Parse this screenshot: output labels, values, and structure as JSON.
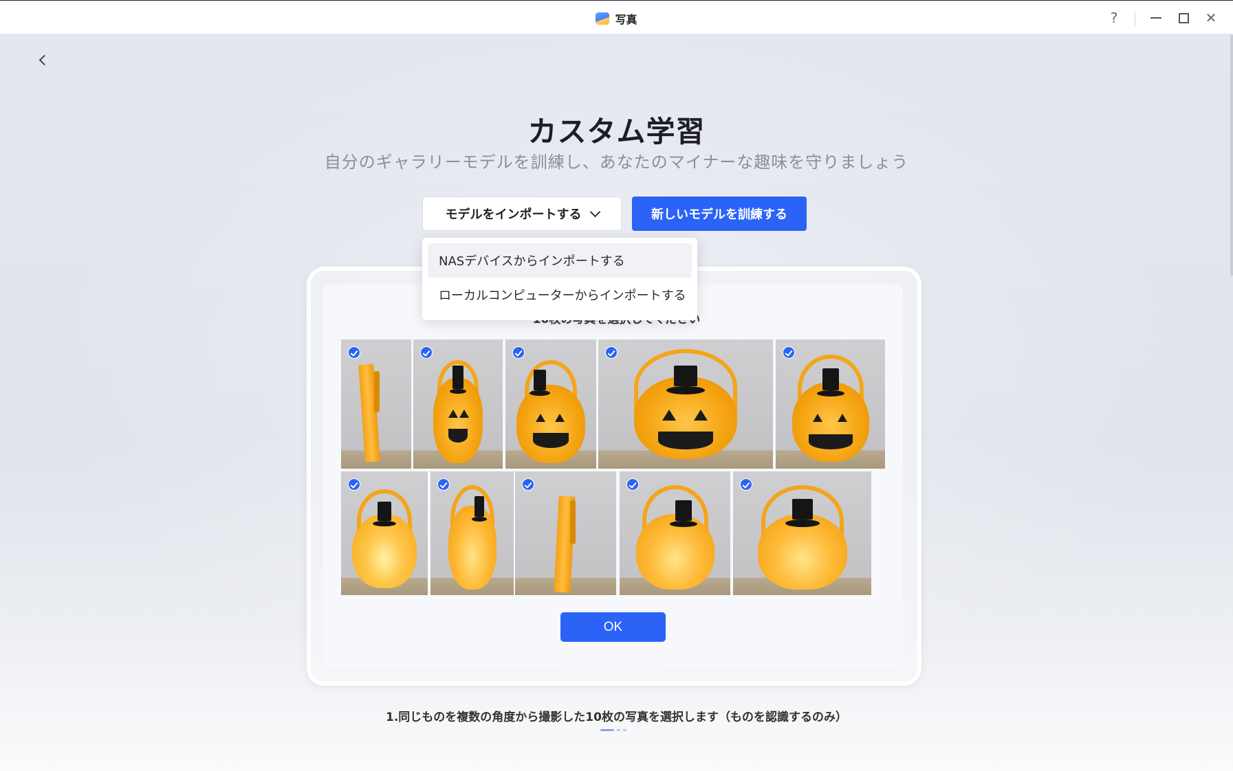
{
  "window": {
    "title": "写真",
    "help_label": "?",
    "close_label": "✕"
  },
  "page": {
    "title": "カスタム学習",
    "subtitle": "自分のギャラリーモデルを訓練し、あなたのマイナーな趣味を守りましょう"
  },
  "toolbar": {
    "import_label": "モデルをインポートする",
    "train_label": "新しいモデルを訓練する"
  },
  "dropdown": {
    "items": [
      {
        "label": "NASデバイスからインポートする",
        "highlighted": true
      },
      {
        "label": "ローカルコンピューターからインポートする",
        "highlighted": false
      }
    ]
  },
  "gallery": {
    "hint": "10枚の写真を選択してください",
    "photos": [
      {
        "subject": "pumpkin-basket-side-view",
        "selected": true
      },
      {
        "subject": "pumpkin-basket-angled-left",
        "selected": true
      },
      {
        "subject": "pumpkin-basket-three-quarter",
        "selected": true
      },
      {
        "subject": "pumpkin-basket-front-wide",
        "selected": true
      },
      {
        "subject": "pumpkin-basket-front",
        "selected": true
      },
      {
        "subject": "pumpkin-basket-front-lit",
        "selected": true
      },
      {
        "subject": "pumpkin-basket-angled-lit",
        "selected": true
      },
      {
        "subject": "pumpkin-basket-side-lit",
        "selected": true
      },
      {
        "subject": "pumpkin-basket-three-quarter-lit",
        "selected": true
      },
      {
        "subject": "pumpkin-basket-front-wide-lit",
        "selected": true
      }
    ],
    "ok_label": "OK"
  },
  "footer": {
    "step_text": "1.同じものを複数の角度から撮影した10枚の写真を選択します（ものを認識するのみ）",
    "current_step": 1,
    "total_steps": 3
  },
  "colors": {
    "accent": "#2a63f6",
    "pumpkin": "#f5a412"
  }
}
